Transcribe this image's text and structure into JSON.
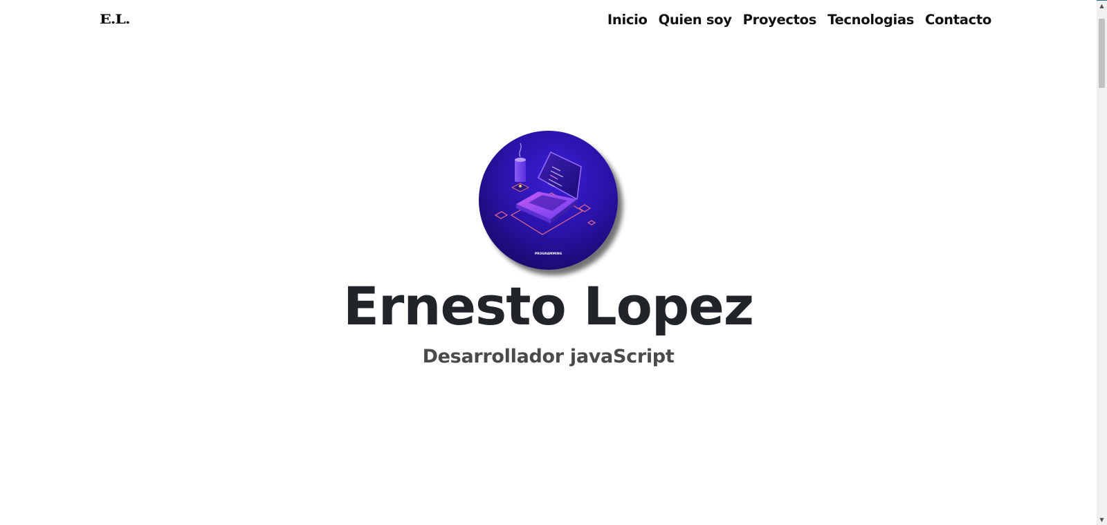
{
  "navbar": {
    "brand": "E.L.",
    "links": [
      {
        "label": "Inicio"
      },
      {
        "label": "Quien soy"
      },
      {
        "label": "Proyectos"
      },
      {
        "label": "Tecnologias"
      },
      {
        "label": "Contacto"
      }
    ]
  },
  "hero": {
    "name": "Ernesto Lopez",
    "role": "Desarrollador javaScript",
    "avatar_caption": "PROGRAMMING"
  },
  "scrollbar": {
    "up_icon": "arrow-up-icon",
    "down_icon": "arrow-down-icon"
  },
  "colors": {
    "text": "#212529",
    "subtitle": "#4a4a4a",
    "avatar_bg": "#2b12a8",
    "accent_line": "#2a6d74"
  }
}
